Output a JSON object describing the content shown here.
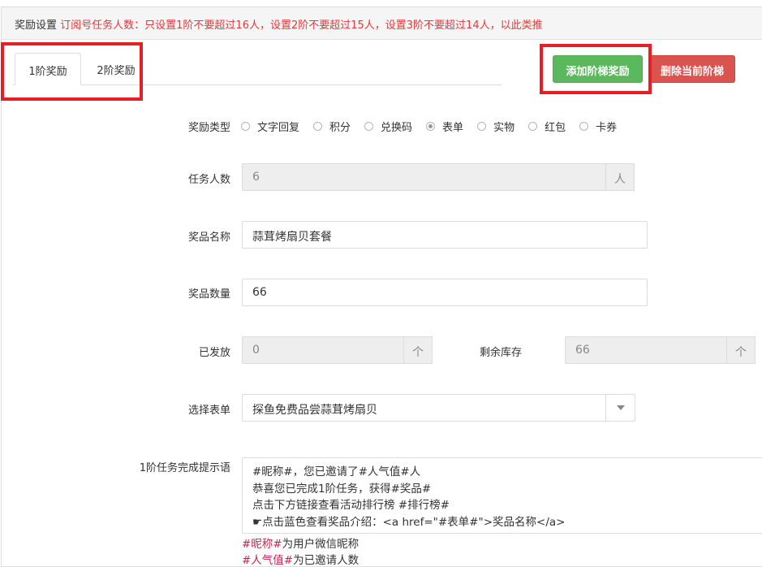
{
  "header": {
    "title": "奖励设置",
    "note": "订阅号任务人数：只设置1阶不要超过16人，设置2阶不要超过15人，设置3阶不要超过14人，以此类推"
  },
  "tabs": [
    {
      "label": "1阶奖励",
      "active": true
    },
    {
      "label": "2阶奖励",
      "active": false
    }
  ],
  "actions": {
    "add_label": "添加阶梯奖励",
    "delete_label": "删除当前阶梯"
  },
  "form": {
    "reward_type": {
      "label": "奖励类型",
      "options": [
        "文字回复",
        "积分",
        "兑换码",
        "表单",
        "实物",
        "红包",
        "卡券"
      ],
      "selected": "表单"
    },
    "task_count": {
      "label": "任务人数",
      "value": "6",
      "unit": "人"
    },
    "prize_name": {
      "label": "奖品名称",
      "value": "蒜茸烤扇贝套餐"
    },
    "prize_quantity": {
      "label": "奖品数量",
      "value": "66"
    },
    "issued": {
      "label": "已发放",
      "value": "0",
      "unit": "个"
    },
    "remaining": {
      "label": "剩余库存",
      "value": "66",
      "unit": "个"
    },
    "select_form": {
      "label": "选择表单",
      "value": "探鱼免费品尝蒜茸烤扇贝"
    },
    "completion_tip": {
      "label": "1阶任务完成提示语",
      "lines": [
        "#昵称#，您已邀请了#人气值#人",
        "恭喜您已完成1阶任务，获得#奖品#",
        "点击下方链接查看活动排行榜 #排行榜#",
        "☛点击蓝色查看奖品介绍：<a href=\"#表单#\">奖品名称</a>"
      ]
    },
    "help": [
      {
        "var": "#昵称#",
        "text": "为用户微信昵称"
      },
      {
        "var": "#人气值#",
        "text": "为已邀请人数"
      }
    ]
  },
  "colors": {
    "note_red": "#e4393c",
    "highlight_red": "#e81e25",
    "add_green": "#5cb85c",
    "delete_red": "#d9534f",
    "var_color": "#c7254e"
  }
}
